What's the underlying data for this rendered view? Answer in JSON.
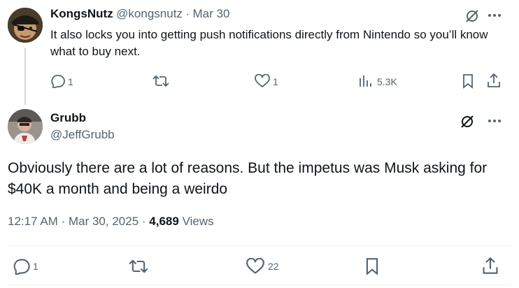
{
  "reply_tweet": {
    "author_name": "KongsNutz",
    "handle": "@kongsnutz",
    "separator": "·",
    "date": "Mar 30",
    "text": "It also locks you into getting push notifications directly from Nintendo so you’ll know what to buy next.",
    "replies": "1",
    "reposts": "",
    "likes": "1",
    "views": "5.3K",
    "avatar_icon": "pirate-eyepatch-avatar"
  },
  "main_tweet": {
    "author_name": "Grubb",
    "handle": "@JeffGrubb",
    "text": "Obviously there are a lot of reasons. But the impetus was Musk asking for $40K a month and being a weirdo",
    "time": "12:17 AM",
    "separator": "·",
    "date": "Mar 30, 2025",
    "separator2": "·",
    "views_count": "4,689",
    "views_label": "Views",
    "replies": "1",
    "reposts": "",
    "likes": "22",
    "avatar_icon": "person-photo-avatar"
  },
  "colors": {
    "text": "#0f1419",
    "muted": "#536471",
    "divider": "#eff3f4",
    "thread_line": "#cfd9de"
  }
}
